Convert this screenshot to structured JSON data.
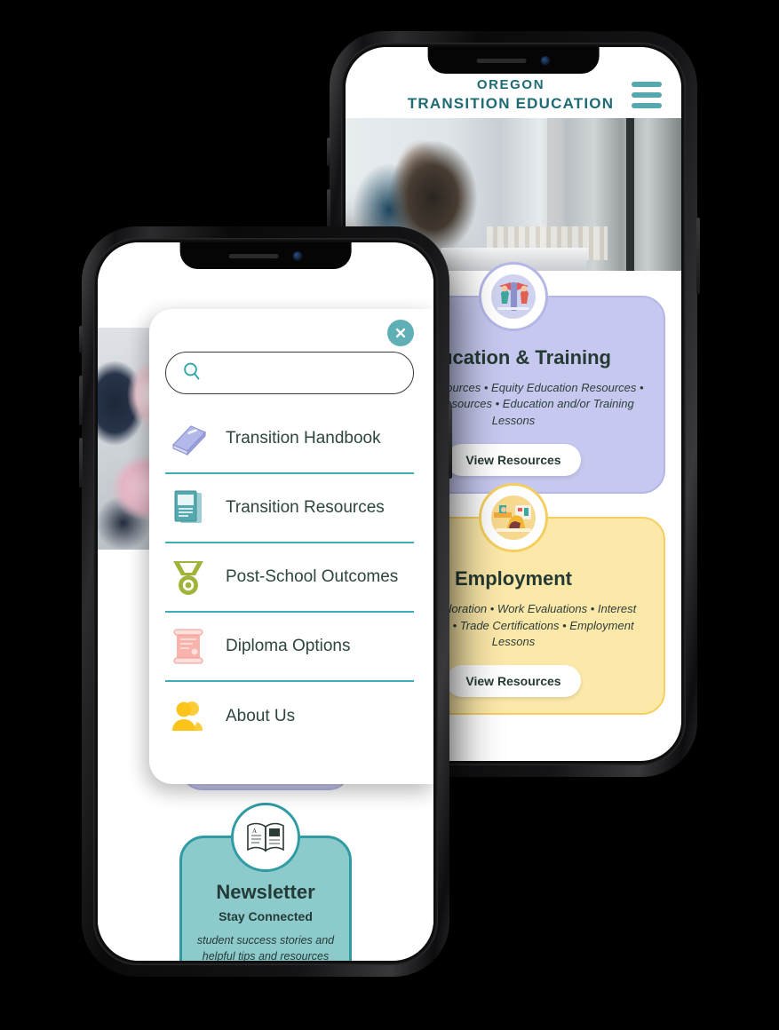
{
  "background_color": "#000000",
  "accent_color": "#3faeb4",
  "brand_color": "#1f6b74",
  "back_phone": {
    "header": {
      "brand_line1": "OREGON",
      "brand_line2": "TRANSITION EDUCATION",
      "menu_icon": "hamburger-icon"
    },
    "hero_image_alt": "student-studying-photo",
    "cards": [
      {
        "id": "education-training",
        "icon": "graduation-illustration-icon",
        "title": "Education & Training",
        "description": "College Resources • Equity Education Resources • Training Resources • Education and/or Training Lessons",
        "button_label": "View Resources",
        "bg_color": "#c6c8ef",
        "border_color": "#b4b6e6"
      },
      {
        "id": "employment",
        "icon": "workplace-illustration-icon",
        "title": "Employment",
        "description": "Career Exploration • Work Evaluations • Interest Inventories • Trade Certifications • Employment Lessons",
        "button_label": "View Resources",
        "bg_color": "#fce8a8",
        "border_color": "#f5cf5e"
      }
    ]
  },
  "front_phone": {
    "menu_overlay": {
      "close_icon": "close-x-icon",
      "search": {
        "icon": "search-icon",
        "value": "",
        "placeholder": ""
      },
      "items": [
        {
          "icon": "book-icon",
          "label": "Transition Handbook",
          "color": "#aab0e6"
        },
        {
          "icon": "document-icon",
          "label": "Transition Resources",
          "color": "#54a8ae"
        },
        {
          "icon": "medal-icon",
          "label": "Post-School Outcomes",
          "color": "#a2b33a"
        },
        {
          "icon": "scroll-icon",
          "label": "Diploma Options",
          "color": "#f4a6a0"
        },
        {
          "icon": "person-icon",
          "label": "About Us",
          "color": "#fcc419"
        }
      ]
    },
    "newsletter_card": {
      "icon": "open-book-icon",
      "title": "Newsletter",
      "subtitle": "Stay Connected",
      "description": "student success stories and helpful tips and resources for transition students, families and educators",
      "bg_color": "#8ccacc",
      "border_color": "#2f9ba2"
    }
  }
}
